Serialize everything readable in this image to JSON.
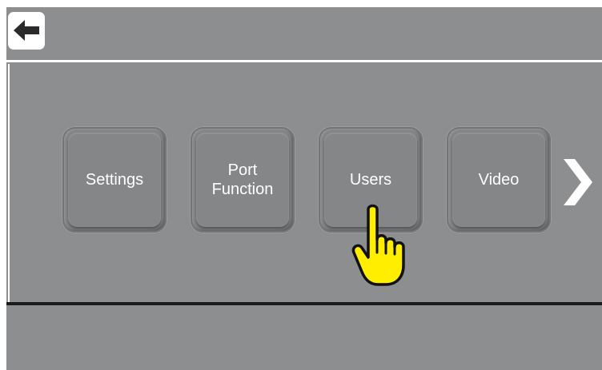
{
  "header": {
    "back_icon": "back-arrow-icon"
  },
  "menu": {
    "tiles": [
      {
        "label": "Settings"
      },
      {
        "label": "Port\nFunction"
      },
      {
        "label": "Users"
      },
      {
        "label": "Video"
      }
    ],
    "next_icon": "chevron-right-icon"
  },
  "pointer": {
    "icon": "pointing-hand-icon",
    "target": "Users"
  },
  "colors": {
    "background": "#8d8e90",
    "tile": "#858688",
    "text": "#ffffff",
    "hand": "#ffee00"
  }
}
